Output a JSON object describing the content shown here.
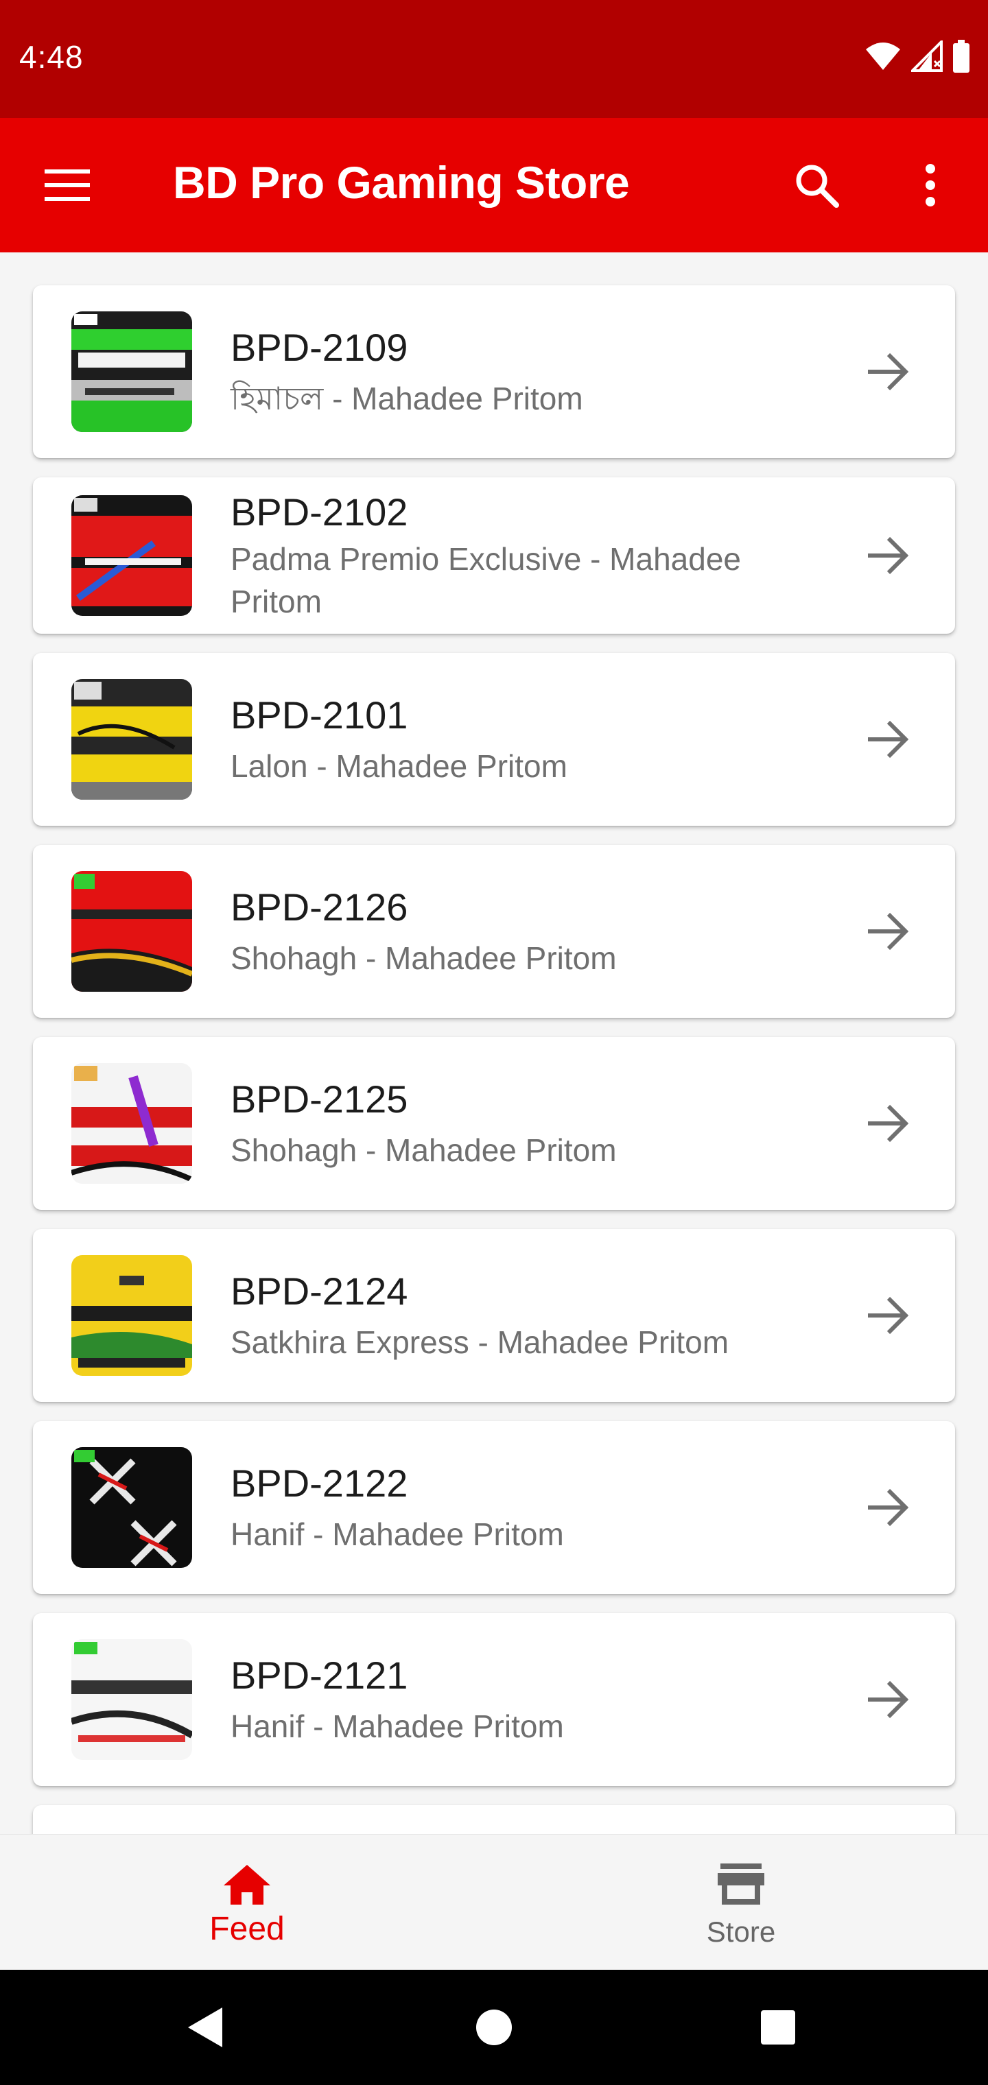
{
  "status_bar": {
    "time": "4:48"
  },
  "app_bar": {
    "title": "BD Pro Gaming Store"
  },
  "items": [
    {
      "title": "BPD-2109",
      "subtitle": "হিমাচল - Mahadee Pritom",
      "thumb": "green-bus"
    },
    {
      "title": "BPD-2102",
      "subtitle": "Padma Premio Exclusive - Mahadee Pritom",
      "thumb": "red-blue-bus"
    },
    {
      "title": "BPD-2101",
      "subtitle": "Lalon - Mahadee Pritom",
      "thumb": "yellow-dark-bus"
    },
    {
      "title": "BPD-2126",
      "subtitle": "Shohagh - Mahadee Pritom",
      "thumb": "red-gold-bus"
    },
    {
      "title": "BPD-2125",
      "subtitle": "Shohagh - Mahadee Pritom",
      "thumb": "white-purple-bus"
    },
    {
      "title": "BPD-2124",
      "subtitle": "Satkhira Express - Mahadee Pritom",
      "thumb": "yellow-green-bus"
    },
    {
      "title": "BPD-2122",
      "subtitle": "Hanif - Mahadee Pritom",
      "thumb": "black-x-bus"
    },
    {
      "title": "BPD-2121",
      "subtitle": "Hanif - Mahadee Pritom",
      "thumb": "white-bus"
    }
  ],
  "bottom_nav": {
    "feed_label": "Feed",
    "store_label": "Store"
  },
  "colors": {
    "status_bar": "#b10000",
    "app_bar": "#e60000",
    "accent": "#e60000",
    "inactive": "#666666"
  }
}
